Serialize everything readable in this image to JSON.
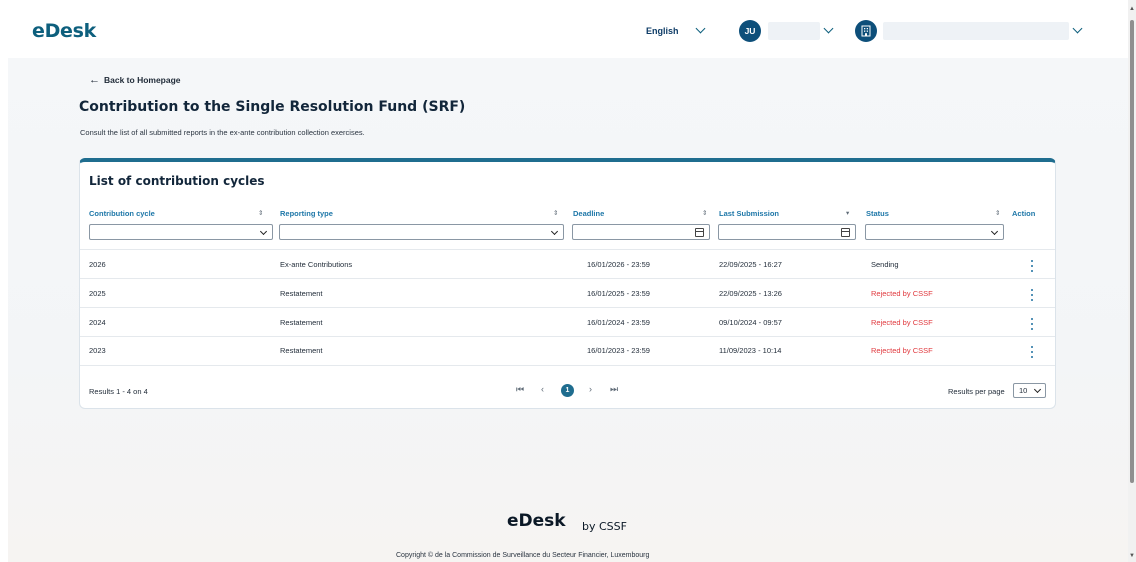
{
  "header": {
    "logo": "eDesk",
    "language": "English",
    "user_initials": "JU",
    "org_icon": "building-icon"
  },
  "page": {
    "back_label": "Back to Homepage",
    "title": "Contribution to the Single Resolution Fund (SRF)",
    "subtitle": "Consult the list of all submitted reports in the ex-ante contribution collection exercises."
  },
  "table": {
    "title": "List of contribution cycles",
    "columns": {
      "cycle": "Contribution cycle",
      "type": "Reporting type",
      "deadline": "Deadline",
      "last": "Last Submission",
      "status": "Status",
      "action": "Action"
    },
    "rows": [
      {
        "cycle": "2026",
        "type": "Ex-ante Contributions",
        "deadline": "16/01/2026 - 23:59",
        "last": "22/09/2025 - 16:27",
        "status": "Sending"
      },
      {
        "cycle": "2025",
        "type": "Restatement",
        "deadline": "16/01/2025 - 23:59",
        "last": "22/09/2025 - 13:26",
        "status": "Rejected by CSSF"
      },
      {
        "cycle": "2024",
        "type": "Restatement",
        "deadline": "16/01/2024 - 23:59",
        "last": "09/10/2024 - 09:57",
        "status": "Rejected by CSSF"
      },
      {
        "cycle": "2023",
        "type": "Restatement",
        "deadline": "16/01/2023 - 23:59",
        "last": "11/09/2023 - 10:14",
        "status": "Rejected by CSSF"
      }
    ],
    "results": "Results 1 - 4 on 4",
    "current_page": "1",
    "results_per_page_label": "Results per page",
    "results_per_page": "10"
  },
  "footer": {
    "logo": "eDesk",
    "by": "by CSSF",
    "copyright": "Copyright © de la Commission de Surveillance du Secteur Financier, Luxembourg"
  },
  "colors": {
    "brand": "#0d5f7d",
    "accent": "#1e77a8",
    "rejected": "#e0393e"
  }
}
